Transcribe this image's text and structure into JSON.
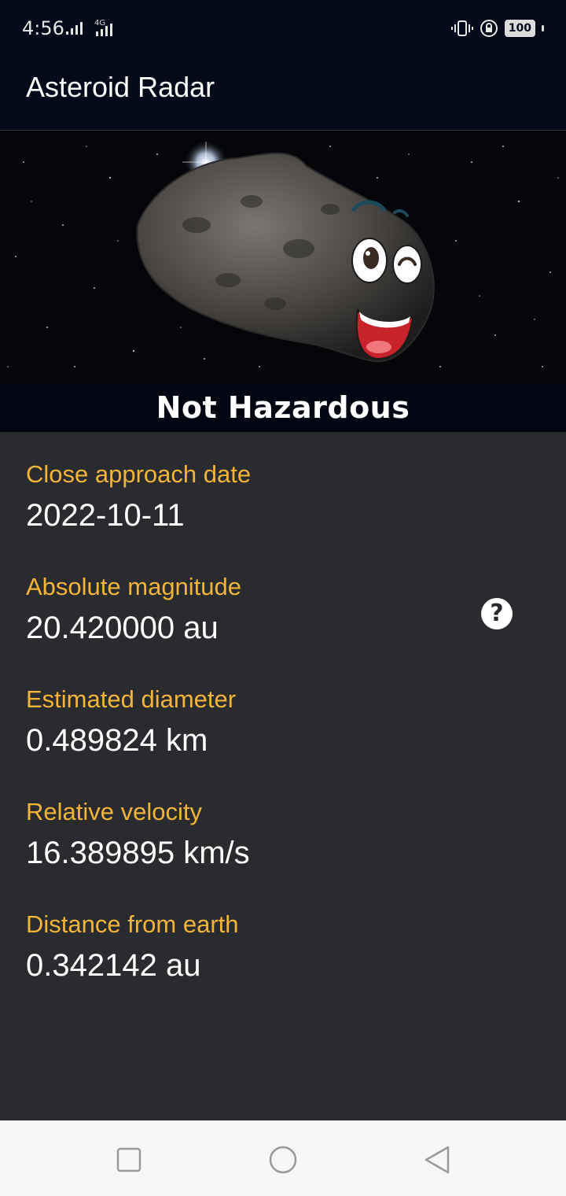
{
  "status": {
    "time": "4:56",
    "network": "4G",
    "battery": "100"
  },
  "app": {
    "title": "Asteroid Radar"
  },
  "hero": {
    "status_label": "Not Hazardous",
    "image_icon": "happy-asteroid-image"
  },
  "details": {
    "close_approach_label": "Close approach date",
    "close_approach_value": "2022-10-11",
    "absolute_magnitude_label": "Absolute magnitude",
    "absolute_magnitude_value": "20.420000 au",
    "estimated_diameter_label": "Estimated diameter",
    "estimated_diameter_value": "0.489824 km",
    "relative_velocity_label": "Relative velocity",
    "relative_velocity_value": "16.389895 km/s",
    "distance_label": "Distance from earth",
    "distance_value": "0.342142 au"
  },
  "help": {
    "label": "?",
    "icon": "help-icon"
  },
  "colors": {
    "app_bar": "#050a1a",
    "background": "#2a2b2e",
    "label_accent": "#f2b53a",
    "value_text": "#ffffff",
    "nav_bar": "#f7f7f7"
  }
}
